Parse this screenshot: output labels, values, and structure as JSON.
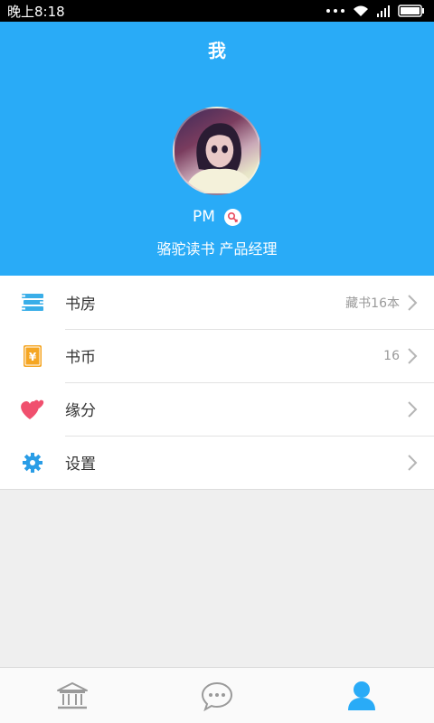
{
  "status_bar": {
    "time": "晚上8:18"
  },
  "header": {
    "title": "我",
    "username": "PM",
    "subtitle": "骆驼读书 产品经理"
  },
  "menu": {
    "items": [
      {
        "label": "书房",
        "value": "藏书16本",
        "icon": "bookshelf-icon"
      },
      {
        "label": "书币",
        "value": "16",
        "icon": "coin-icon"
      },
      {
        "label": "缘分",
        "value": "",
        "icon": "hearts-icon"
      },
      {
        "label": "设置",
        "value": "",
        "icon": "gear-icon"
      }
    ]
  },
  "tabs": [
    {
      "icon": "library-icon",
      "active": false
    },
    {
      "icon": "chat-icon",
      "active": false
    },
    {
      "icon": "profile-icon",
      "active": true
    }
  ],
  "colors": {
    "header_bg": "#29abf7",
    "accent": "#29abf7",
    "coin": "#f5a623",
    "heart": "#f0506e",
    "tab_inactive": "#9a9a9a"
  }
}
